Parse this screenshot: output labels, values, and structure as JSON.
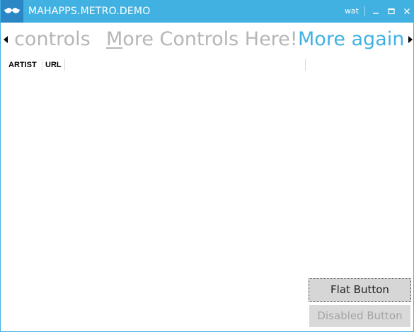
{
  "window": {
    "title": "MAHAPPS.METRO.DEMO",
    "title_command": "wat",
    "accent_color": "#41b1e1",
    "icon": "mustache-icon"
  },
  "tabs": {
    "items": [
      {
        "label": "f controls",
        "selected": false
      },
      {
        "label_access_key": "M",
        "label_rest": "ore Controls Here!",
        "selected": false
      },
      {
        "label": "More again",
        "selected": true
      }
    ],
    "scroll_left_icon": "caret-left-icon",
    "scroll_right_icon": "caret-right-icon"
  },
  "grid": {
    "columns": [
      "ARTIST",
      "URL"
    ]
  },
  "buttons": {
    "flat_label": "Flat Button",
    "disabled_label": "Disabled Button"
  }
}
